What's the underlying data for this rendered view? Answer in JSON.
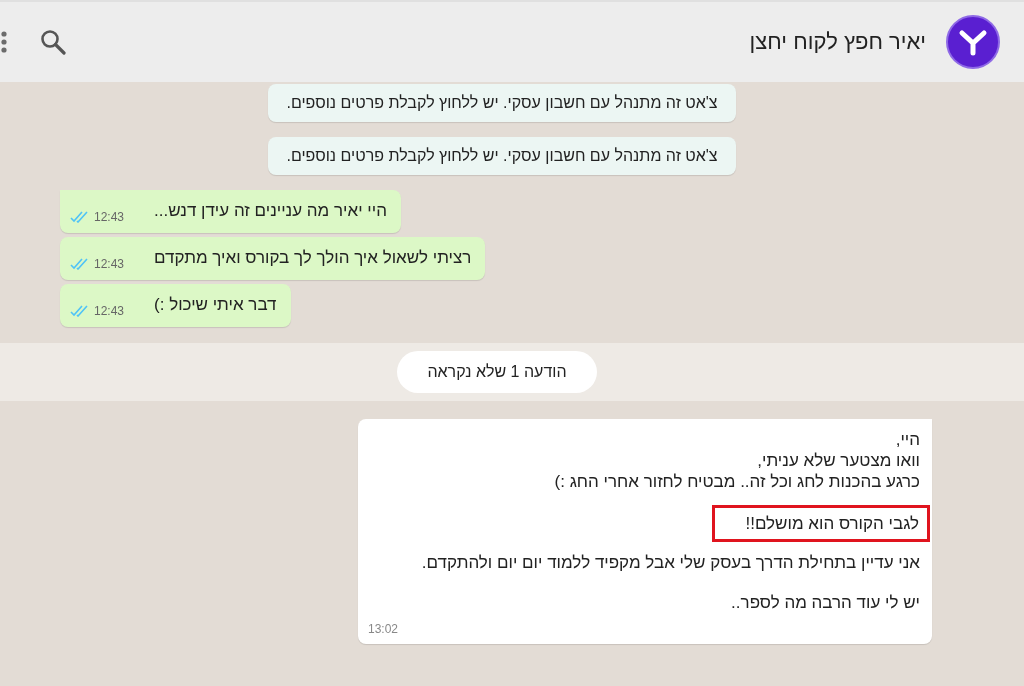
{
  "header": {
    "title": "יאיר חפץ לקוח יחצן"
  },
  "messages": [
    {
      "kind": "system",
      "text": "צ'אט זה מתנהל עם חשבון עסקי. יש ללחוץ לקבלת פרטים נוספים."
    },
    {
      "kind": "system",
      "text": "צ'אט זה מתנהל עם חשבון עסקי. יש ללחוץ לקבלת פרטים נוספים."
    },
    {
      "kind": "outgoing",
      "text": "היי יאיר מה עניינים זה עידן דנש...",
      "time": "12:43",
      "read": true,
      "tail": true
    },
    {
      "kind": "outgoing",
      "text": "רציתי לשאול איך הולך לך בקורס ואיך מתקדם",
      "time": "12:43",
      "read": true,
      "tail": false
    },
    {
      "kind": "outgoing",
      "text": "דבר איתי שיכול :)",
      "time": "12:43",
      "read": true,
      "tail": false
    },
    {
      "kind": "unread",
      "text": "הודעה 1 שלא נקראה"
    },
    {
      "kind": "incoming",
      "time": "13:02",
      "paragraphs": [
        {
          "lines": [
            "היי,",
            "וואו מצטער שלא עניתי,",
            "כרגע בהכנות לחג וכל זה.. מבטיח לחזור אחרי החג :)"
          ],
          "highlighted": false
        },
        {
          "lines": [
            "לגבי הקורס הוא מושלם!!"
          ],
          "highlighted": true
        },
        {
          "lines": [
            "אני עדיין בתחילת הדרך בעסק שלי אבל מקפיד ללמוד יום יום ולהתקדם."
          ],
          "highlighted": false
        },
        {
          "lines": [
            "יש לי עוד הרבה מה לספר.."
          ],
          "highlighted": false
        }
      ]
    }
  ]
}
